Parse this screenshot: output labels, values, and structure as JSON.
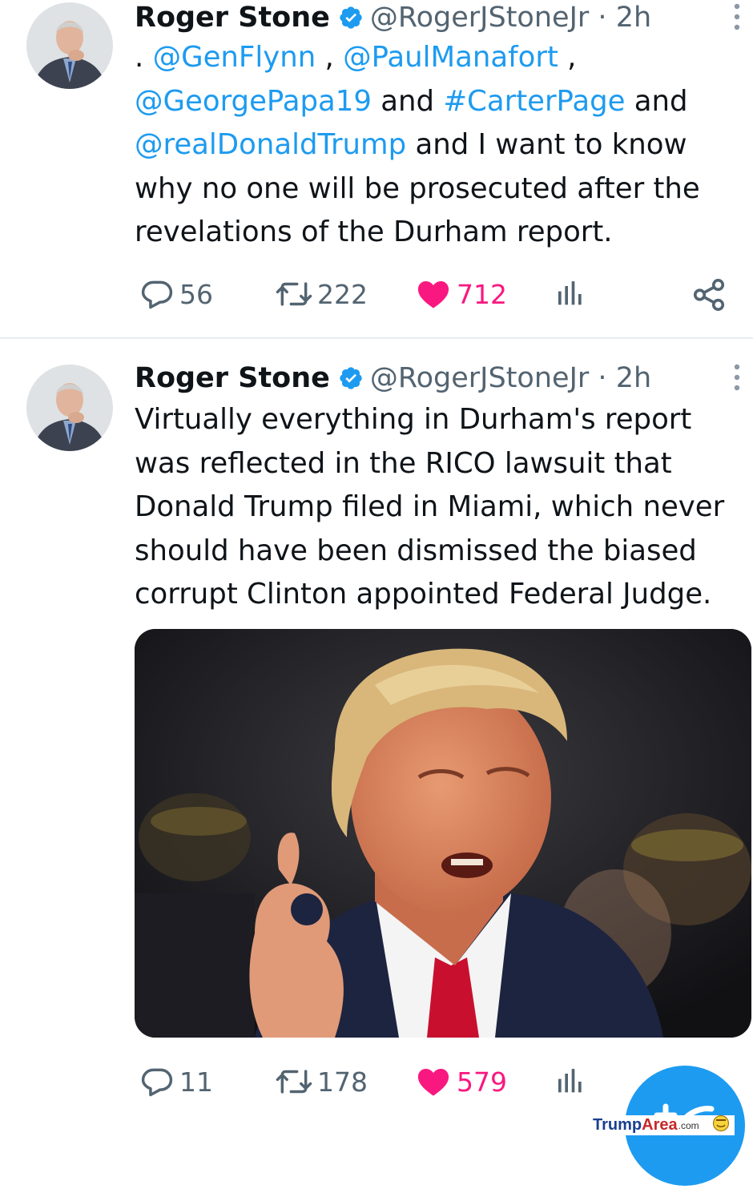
{
  "tweets": [
    {
      "author": {
        "name": "Roger Stone",
        "handle": "@RogerJStoneJr",
        "time": "2h",
        "separator": "·"
      },
      "text_parts": [
        {
          "t": ". ",
          "link": false
        },
        {
          "t": "@GenFlynn",
          "link": true
        },
        {
          "t": " , ",
          "link": false
        },
        {
          "t": "@PaulManafort",
          "link": true
        },
        {
          "t": " , ",
          "link": false
        },
        {
          "t": "@GeorgePapa19",
          "link": true
        },
        {
          "t": " and ",
          "link": false
        },
        {
          "t": "#CarterPage",
          "link": true
        },
        {
          "t": " and ",
          "link": false
        },
        {
          "t": "@realDonaldTrump",
          "link": true
        },
        {
          "t": " and I want to know why no one will be prosecuted after the revelations of the Durham report.",
          "link": false
        }
      ],
      "stats": {
        "replies": "56",
        "retweets": "222",
        "likes": "712"
      }
    },
    {
      "author": {
        "name": "Roger Stone",
        "handle": "@RogerJStoneJr",
        "time": "2h",
        "separator": "·"
      },
      "text": "Virtually everything in Durham's report was reflected in the RICO lawsuit that Donald Trump filed in Miami, which never should have been dismissed the biased corrupt Clinton appointed Federal Judge.",
      "stats": {
        "replies": "11",
        "retweets": "178",
        "likes": "579"
      }
    }
  ],
  "watermark": {
    "brand_a": "Trump",
    "brand_b": "Area",
    "suffix": ".com"
  },
  "colors": {
    "link": "#1d9bf0",
    "like": "#f91880",
    "muted": "#536471",
    "text": "#0f1419"
  },
  "icons": [
    "reply-icon",
    "retweet-icon",
    "like-icon",
    "views-icon",
    "share-icon",
    "more-icon",
    "verified-icon",
    "compose-icon"
  ]
}
